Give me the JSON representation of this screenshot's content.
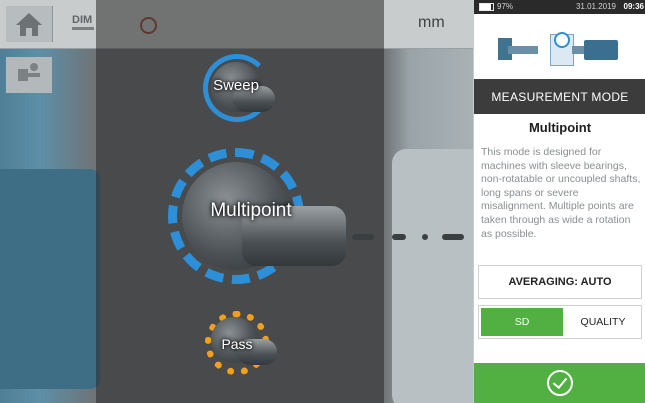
{
  "app": {
    "dimension_label": "DIM",
    "unit_label": "mm"
  },
  "modes": [
    {
      "label": "Sweep"
    },
    {
      "label": "Multipoint"
    },
    {
      "label": "Pass"
    }
  ],
  "status": {
    "battery": "97%",
    "date": "31.01.2019",
    "time": "09:36"
  },
  "panel": {
    "header": "MEASUREMENT MODE",
    "selected_mode": "Multipoint",
    "description": "This mode is designed for machines with sleeve bearings, non-rotatable or uncoupled shafts, long spans or severe misalignment. Multiple points are taken through as wide a rotation as possible.",
    "averaging_label": "AVERAGING: AUTO",
    "toggle": {
      "left_label": "SD",
      "right_label": "QUALITY",
      "selected": "SD"
    }
  },
  "colors": {
    "accent_green": "#52b043",
    "ring_blue": "#2d8fd8",
    "ring_orange": "#f2a01c",
    "header_dark": "#3c3c3c"
  }
}
